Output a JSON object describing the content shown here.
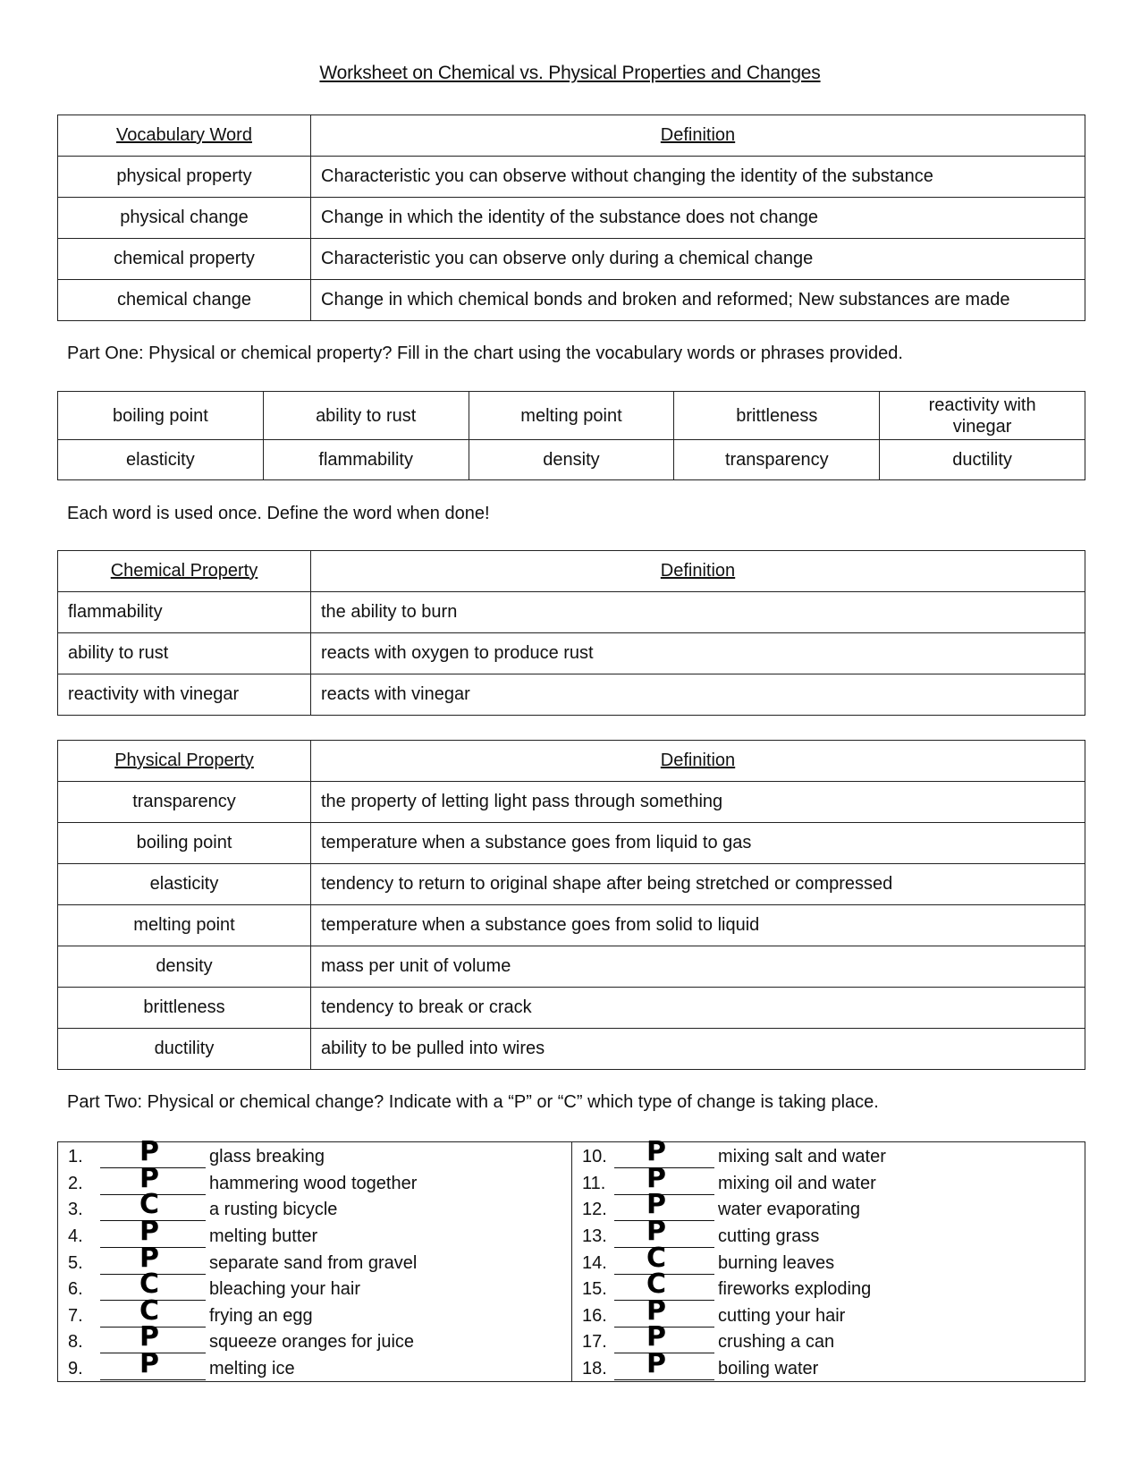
{
  "title": "Worksheet on Chemical vs. Physical Properties and Changes",
  "vocab_table": {
    "headers": [
      "Vocabulary Word",
      "Definition"
    ],
    "rows": [
      {
        "word": "physical property",
        "definition": "Characteristic you can observe without changing the identity of the substance"
      },
      {
        "word": "physical change",
        "definition": "Change in which the identity of the substance does not change"
      },
      {
        "word": "chemical property",
        "definition": "Characteristic you can observe only during a chemical change"
      },
      {
        "word": "chemical change",
        "definition": "Change in which chemical bonds and broken and reformed; New substances are made"
      }
    ]
  },
  "part_one": {
    "instructions": "Part One: Physical or chemical property? Fill in the chart using the vocabulary words or phrases provided.",
    "word_bank": [
      [
        "boiling point",
        "ability to rust",
        "melting point",
        "brittleness",
        "reactivity with vinegar"
      ],
      [
        "elasticity",
        "flammability",
        "density",
        "transparency",
        "ductility"
      ]
    ],
    "note": "Each word is used once. Define the word when done!"
  },
  "chemical_table": {
    "headers": [
      "Chemical Property",
      "Definition"
    ],
    "rows": [
      {
        "word": "flammability",
        "definition": "the ability to burn"
      },
      {
        "word": "ability to rust",
        "definition": "reacts with oxygen to produce rust"
      },
      {
        "word": "reactivity with vinegar",
        "definition": "reacts with vinegar"
      }
    ]
  },
  "physical_table": {
    "headers": [
      "Physical Property",
      "Definition"
    ],
    "rows": [
      {
        "word": "transparency",
        "definition": "the property of letting light pass through something"
      },
      {
        "word": "boiling point",
        "definition": "temperature when a substance goes from liquid to gas"
      },
      {
        "word": "elasticity",
        "definition": "tendency to return to original shape after being stretched or compressed"
      },
      {
        "word": "melting point",
        "definition": "temperature when a substance goes from solid to liquid"
      },
      {
        "word": "density",
        "definition": "mass per unit of volume"
      },
      {
        "word": "brittleness",
        "definition": "tendency to break or crack"
      },
      {
        "word": "ductility",
        "definition": "ability to be pulled into wires"
      }
    ]
  },
  "part_two": {
    "instructions": "Part Two: Physical or chemical change? Indicate with a “P” or “C” which type of change is taking place.",
    "left": [
      {
        "num": "1.",
        "answer": "P",
        "text": "glass breaking"
      },
      {
        "num": "2.",
        "answer": "P",
        "text": "hammering wood together"
      },
      {
        "num": "3.",
        "answer": "C",
        "text": "a rusting bicycle"
      },
      {
        "num": "4.",
        "answer": "P",
        "text": "melting butter"
      },
      {
        "num": "5.",
        "answer": "P",
        "text": "separate sand from gravel"
      },
      {
        "num": "6.",
        "answer": "C",
        "text": "bleaching your hair"
      },
      {
        "num": "7.",
        "answer": "C",
        "text": "frying an egg"
      },
      {
        "num": "8.",
        "answer": "P",
        "text": "squeeze oranges for juice"
      },
      {
        "num": "9.",
        "answer": "P",
        "text": "melting ice"
      }
    ],
    "right": [
      {
        "num": "10.",
        "answer": "P",
        "text": "mixing salt and water"
      },
      {
        "num": "11.",
        "answer": "P",
        "text": "mixing oil and water"
      },
      {
        "num": "12.",
        "answer": "P",
        "text": "water evaporating"
      },
      {
        "num": "13.",
        "answer": "P",
        "text": "cutting grass"
      },
      {
        "num": "14.",
        "answer": "C",
        "text": "burning leaves"
      },
      {
        "num": "15.",
        "answer": "C",
        "text": "fireworks exploding"
      },
      {
        "num": "16.",
        "answer": "P",
        "text": "cutting your hair"
      },
      {
        "num": "17.",
        "answer": "P",
        "text": "crushing a can"
      },
      {
        "num": "18.",
        "answer": "P",
        "text": "boiling water"
      }
    ]
  }
}
